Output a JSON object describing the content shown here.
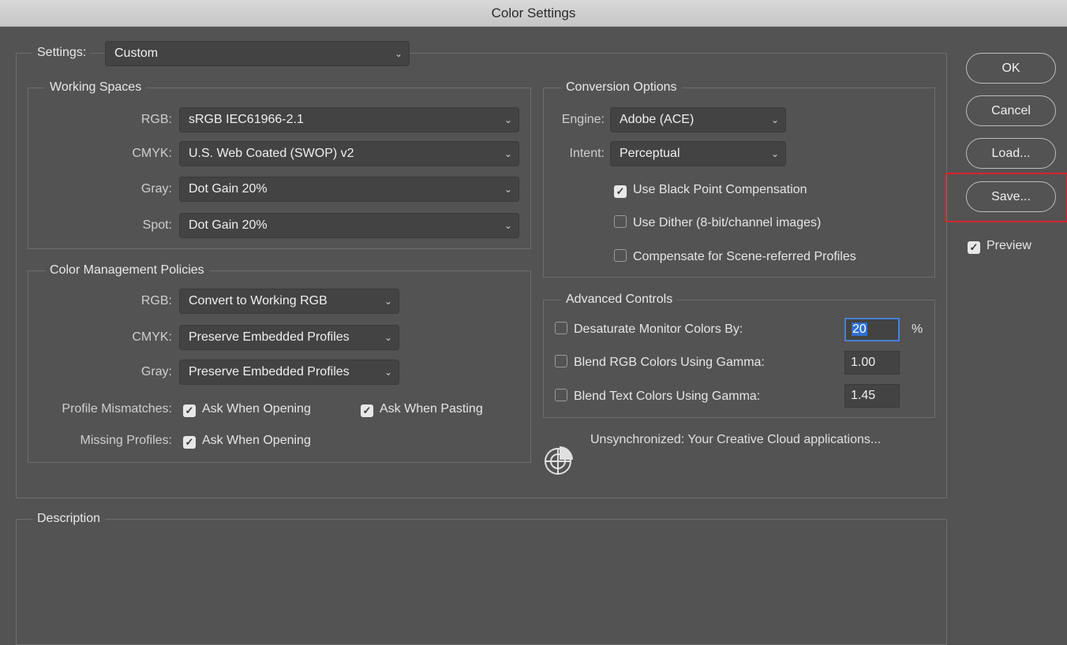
{
  "window": {
    "title": "Color Settings"
  },
  "settings": {
    "label": "Settings:",
    "value": "Custom"
  },
  "working_spaces": {
    "title": "Working Spaces",
    "rgb": {
      "label": "RGB:",
      "value": "sRGB IEC61966-2.1"
    },
    "cmyk": {
      "label": "CMYK:",
      "value": "U.S. Web Coated (SWOP) v2"
    },
    "gray": {
      "label": "Gray:",
      "value": "Dot Gain 20%"
    },
    "spot": {
      "label": "Spot:",
      "value": "Dot Gain 20%"
    }
  },
  "policies": {
    "title": "Color Management Policies",
    "rgb": {
      "label": "RGB:",
      "value": "Convert to Working RGB"
    },
    "cmyk": {
      "label": "CMYK:",
      "value": "Preserve Embedded Profiles"
    },
    "gray": {
      "label": "Gray:",
      "value": "Preserve Embedded Profiles"
    },
    "mismatch_label": "Profile Mismatches:",
    "ask_opening": "Ask When Opening",
    "ask_pasting": "Ask When Pasting",
    "missing_label": "Missing Profiles:",
    "missing_ask_opening": "Ask When Opening"
  },
  "conversion": {
    "title": "Conversion Options",
    "engine": {
      "label": "Engine:",
      "value": "Adobe (ACE)"
    },
    "intent": {
      "label": "Intent:",
      "value": "Perceptual"
    },
    "black_point": "Use Black Point Compensation",
    "dither": "Use Dither (8-bit/channel images)",
    "scene_referred": "Compensate for Scene-referred Profiles"
  },
  "advanced": {
    "title": "Advanced Controls",
    "desaturate": {
      "label": "Desaturate Monitor Colors By:",
      "value": "20",
      "unit": "%"
    },
    "blend_rgb": {
      "label": "Blend RGB Colors Using Gamma:",
      "value": "1.00"
    },
    "blend_text": {
      "label": "Blend Text Colors Using Gamma:",
      "value": "1.45"
    }
  },
  "sync_status": "Unsynchronized: Your Creative Cloud applications...",
  "description": {
    "title": "Description"
  },
  "buttons": {
    "ok": "OK",
    "cancel": "Cancel",
    "load": "Load...",
    "save": "Save..."
  },
  "preview": {
    "label": "Preview"
  },
  "icons": {
    "dropdown": "chevron-down-icon",
    "check": "checkmark-icon",
    "sync": "color-sync-icon"
  },
  "colors": {
    "background": "#535353",
    "highlight": "#d9232b",
    "selection": "#2f6fd1"
  }
}
